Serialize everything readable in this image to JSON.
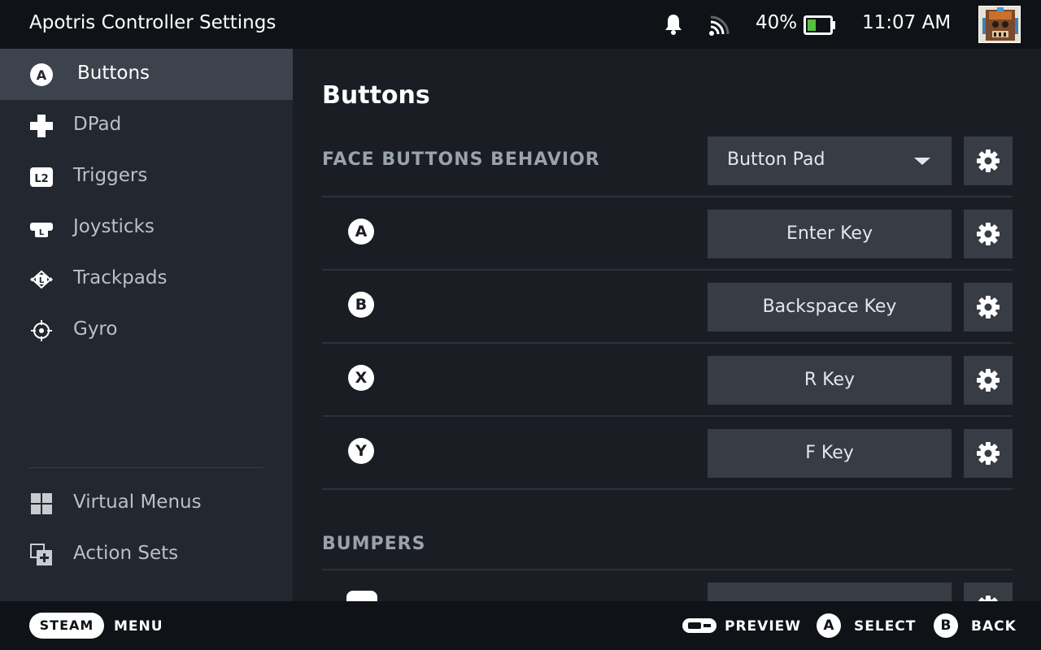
{
  "header": {
    "title": "Apotris Controller Settings",
    "battery_percent": "40%",
    "battery_level": 0.4,
    "time": "11:07 AM"
  },
  "sidebar": {
    "items": [
      {
        "label": "Buttons",
        "icon": "a-button-icon",
        "active": true
      },
      {
        "label": "DPad",
        "icon": "dpad-icon"
      },
      {
        "label": "Triggers",
        "icon": "l2-trigger-icon"
      },
      {
        "label": "Joysticks",
        "icon": "joystick-icon"
      },
      {
        "label": "Trackpads",
        "icon": "trackpad-icon"
      },
      {
        "label": "Gyro",
        "icon": "gyro-icon"
      }
    ],
    "bottom_items": [
      {
        "label": "Virtual Menus",
        "icon": "grid-icon"
      },
      {
        "label": "Action Sets",
        "icon": "action-sets-icon"
      }
    ],
    "a_glyph": "A",
    "l2_glyph": "L2",
    "l_glyph": "L"
  },
  "main": {
    "title": "Buttons",
    "face_section": {
      "heading": "FACE BUTTONS BEHAVIOR",
      "dropdown_value": "Button Pad",
      "rows": [
        {
          "glyph": "A",
          "binding": "Enter Key"
        },
        {
          "glyph": "B",
          "binding": "Backspace Key"
        },
        {
          "glyph": "X",
          "binding": "R Key"
        },
        {
          "glyph": "Y",
          "binding": "F Key"
        }
      ]
    },
    "bumpers_section": {
      "heading": "BUMPERS"
    }
  },
  "footer": {
    "steam_label": "STEAM",
    "menu_label": "MENU",
    "preview_label": "PREVIEW",
    "select_glyph": "A",
    "select_label": "SELECT",
    "back_glyph": "B",
    "back_label": "BACK"
  },
  "colors": {
    "background": "#1a1d24",
    "sidebar": "#23272f",
    "sidebar_active": "#3d434d",
    "button_bg": "#373c45",
    "header_footer": "#0f1217",
    "battery_fill": "#59bf40"
  }
}
